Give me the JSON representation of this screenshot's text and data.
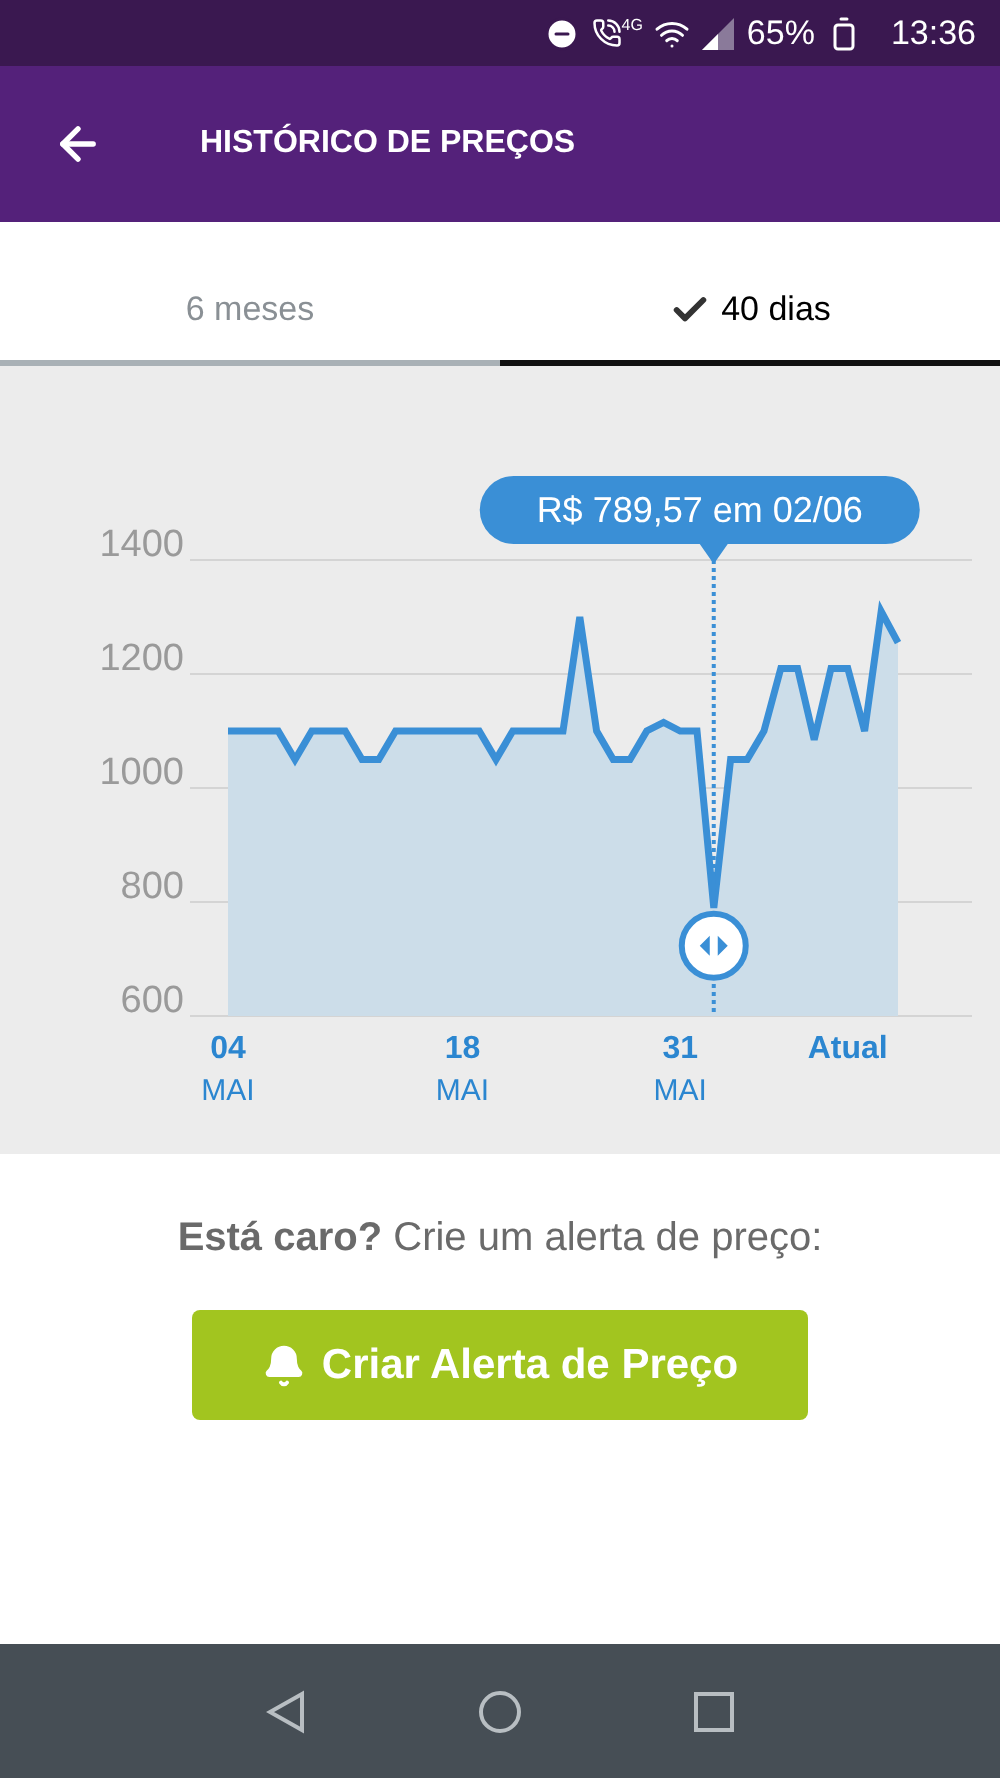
{
  "status_bar": {
    "network": "4G",
    "battery": "65%",
    "time": "13:36"
  },
  "app_bar": {
    "title": "HISTÓRICO DE PREÇOS"
  },
  "tabs": [
    {
      "label": "6 meses",
      "selected": false
    },
    {
      "label": "40 dias",
      "selected": true
    }
  ],
  "chart_data": {
    "type": "area",
    "categories": [
      "04 MAI",
      null,
      null,
      null,
      null,
      null,
      null,
      null,
      null,
      null,
      null,
      null,
      null,
      null,
      "18 MAI",
      null,
      null,
      null,
      null,
      null,
      null,
      null,
      null,
      null,
      null,
      null,
      null,
      "31 MAI",
      null,
      null,
      null,
      null,
      null,
      null,
      null,
      null,
      null,
      "Atual",
      null,
      null,
      null
    ],
    "series": [
      {
        "color": "#3a8fd6",
        "values": [
          1100,
          1100,
          1100,
          1100,
          1050,
          1100,
          1100,
          1100,
          1050,
          1050,
          1100,
          1100,
          1100,
          1100,
          1100,
          1100,
          1050,
          1100,
          1100,
          1100,
          1100,
          1300,
          1100,
          1050,
          1050,
          1100,
          1115,
          1100,
          1100,
          790,
          1050,
          1050,
          1100,
          1210,
          1210,
          1085,
          1210,
          1210,
          1100,
          1310,
          1255
        ]
      }
    ],
    "ylim": [
      600,
      1400
    ],
    "yticks": [
      600,
      800,
      1000,
      1200,
      1400
    ],
    "grid": true,
    "annotations": [
      {
        "text": "R$ 789,57 em 02/06"
      }
    ]
  },
  "prompt": "**Está caro?** Crie um alerta de preço:",
  "alert_button": {
    "label": "Criar Alerta de Preço"
  }
}
